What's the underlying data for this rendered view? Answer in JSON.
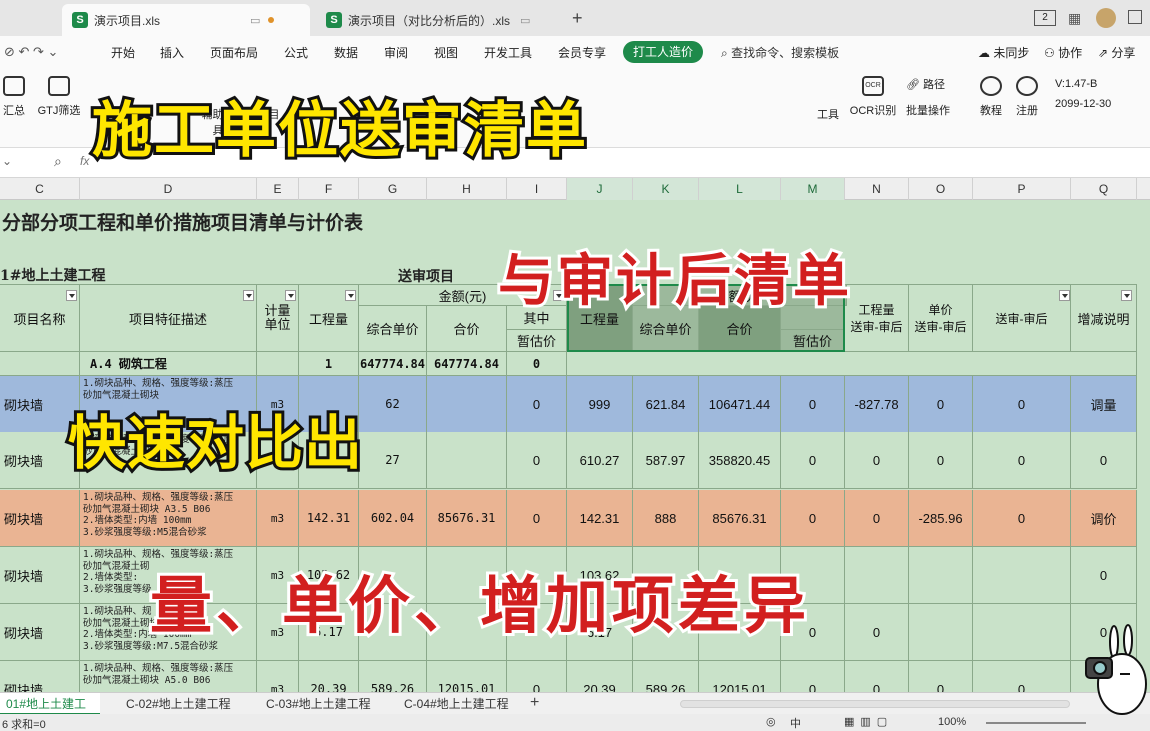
{
  "window": {
    "tabs": [
      {
        "label": "演示项目.xls"
      },
      {
        "label": "演示项目（对比分析后的）.xls"
      }
    ],
    "new_tab": "+",
    "page_indicator": "2"
  },
  "menu": {
    "items": [
      "开始",
      "插入",
      "页面布局",
      "公式",
      "数据",
      "审阅",
      "视图",
      "开发工具",
      "会员专享"
    ],
    "active_pill": "打工人造价",
    "search_placeholder": "查找命令、搜索模板",
    "right": [
      "未同步",
      "协作",
      "分享"
    ]
  },
  "toolbar": {
    "left_tools": [
      "汇总",
      "GTJ筛选"
    ],
    "partial_tools": [
      "辅助工具",
      "表格目录",
      "工具"
    ],
    "right_tools": [
      "OCR识别",
      "路径",
      "批量操作",
      "教程",
      "注册"
    ],
    "ocr_icon": "OCR",
    "version": "V:1.47-B",
    "date": "2099-12-30"
  },
  "formula": {
    "fx": "fx"
  },
  "columns": [
    "C",
    "D",
    "E",
    "F",
    "G",
    "H",
    "I",
    "J",
    "K",
    "L",
    "M",
    "N",
    "O",
    "P",
    "Q"
  ],
  "sheet": {
    "title": "分部分项工程和单价措施项目清单与计价表",
    "project_name": "1#地上土建工程",
    "submitted_label": "送审项目",
    "headers": {
      "name": "项目名称",
      "desc": "项目特征描述",
      "unit": "计量单位",
      "qty": "工程量",
      "amount": "金额(元)",
      "unit_price": "综合单价",
      "total": "合价",
      "other": "其中",
      "provisional": "暂估价",
      "qty2": "工程量",
      "unit_price2": "综合单价",
      "total2": "合价",
      "amount2": "金额(元)",
      "provisional2": "暂估价",
      "diff_qty_top": "工程量",
      "diff_qty": "送审-审后",
      "diff_price_top": "单价",
      "diff_price": "送审-审后",
      "diff_total": "送审-审后",
      "remark": "增减说明"
    },
    "section": {
      "name": "A.4 砌筑工程",
      "qty": "1",
      "unit_price": "647774.84",
      "total": "647774.84",
      "provisional": "0"
    },
    "rows": [
      {
        "name": "砌块墙",
        "desc": [
          "1.砌块品种、规格、强度等级:蒸压",
          "砂加气混凝土砌块"
        ],
        "unit": "m3",
        "qty": "",
        "price": "62",
        "total": "",
        "prov": "0",
        "aq": "999",
        "ap": "621.84",
        "at": "106471.44",
        "aprov": "0",
        "dq": "-827.78",
        "dp": "0",
        "dt": "0",
        "remark": "调量"
      },
      {
        "name": "砌块墙",
        "desc": [
          "1.砌块品种、规格、强度等级:蒸压",
          "砂加气混凝土砌块"
        ],
        "unit": "m3",
        "qty": "",
        "price": "27",
        "total": "",
        "prov": "0",
        "aq": "610.27",
        "ap": "587.97",
        "at": "358820.45",
        "aprov": "0",
        "dq": "0",
        "dp": "0",
        "dt": "0",
        "remark": "0"
      },
      {
        "name": "砌块墙",
        "desc": [
          "1.砌块品种、规格、强度等级:蒸压",
          "砂加气混凝土砌块 A3.5 B06",
          "2.墙体类型:内墙 100mm",
          "3.砂浆强度等级:M5混合砂浆"
        ],
        "unit": "m3",
        "qty": "142.31",
        "price": "602.04",
        "total": "85676.31",
        "prov": "0",
        "aq": "142.31",
        "ap": "888",
        "at": "85676.31",
        "aprov": "0",
        "dq": "0",
        "dp": "-285.96",
        "dt": "0",
        "remark": "调价"
      },
      {
        "name": "砌块墙",
        "desc": [
          "1.砌块品种、规格、强度等级:蒸压",
          "砂加气混凝土砌",
          "2.墙体类型:",
          "3.砂浆强度等级"
        ],
        "unit": "m3",
        "qty": "103.62",
        "price": "",
        "total": "",
        "prov": "",
        "aq": "103.62",
        "ap": "",
        "at": "",
        "aprov": "",
        "dq": "",
        "dp": "",
        "dt": "",
        "remark": "0"
      },
      {
        "name": "砌块墙",
        "desc": [
          "1.砌块品种、规",
          "砂加气混凝土砌块",
          "2.墙体类型:内墙 100mm",
          "3.砂浆强度等级:M7.5混合砂浆"
        ],
        "unit": "m3",
        "qty": "6.17",
        "price": "",
        "total": "",
        "prov": "",
        "aq": "6.17",
        "ap": "",
        "at": "",
        "aprov": "0",
        "dq": "0",
        "dp": "",
        "dt": "",
        "remark": "0"
      },
      {
        "name": "砌块墙",
        "desc": [
          "1.砌块品种、规格、强度等级:蒸压",
          "砂加气混凝土砌块 A5.0 B06"
        ],
        "unit": "m3",
        "qty": "20.39",
        "price": "589.26",
        "total": "12015.01",
        "prov": "0",
        "aq": "20.39",
        "ap": "589.26",
        "at": "12015.01",
        "aprov": "0",
        "dq": "0",
        "dp": "0",
        "dt": "0",
        "remark": "0"
      }
    ]
  },
  "sheet_tabs": [
    "01#地上土建工程",
    "C-02#地上土建工程",
    "C-03#地上土建工程",
    "C-04#地上土建工程"
  ],
  "status": {
    "left": "6  求和=0",
    "zoom": "100%"
  },
  "overlay": {
    "title": "施工单位送审清单",
    "subtitle": "与审计后清单",
    "compare": "快速对比出",
    "diff": "量、单价、增加项差异"
  },
  "colors": {
    "green": "#1e8a4a",
    "sheet_bg": "#c9e2c9",
    "blue_row": "#9fb9dc",
    "orange_row": "#eab493",
    "yellow": "#ffe600",
    "red": "#d21f1f"
  }
}
